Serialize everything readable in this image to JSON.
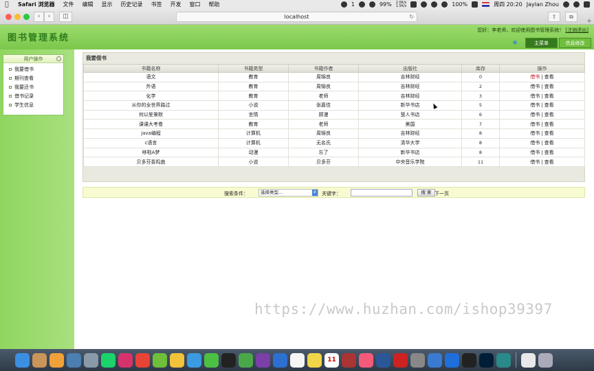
{
  "menubar": {
    "app_name": "Safari 浏览器",
    "items": [
      "文件",
      "编辑",
      "显示",
      "历史记录",
      "书签",
      "开发",
      "窗口",
      "帮助"
    ],
    "status": {
      "notif": "1",
      "battery": "100%",
      "cpu": "99%",
      "net_up": "2.0K/s",
      "net_down": "1.5K/s",
      "datetime": "周四 20:20",
      "user": "Jaylan Zhou"
    }
  },
  "browser": {
    "url": "localhost"
  },
  "app": {
    "brand": "图书管理系统",
    "greeting": "您好：李老师，欢迎使用图书管理系统！",
    "logout": "[注销退出]",
    "tabs": [
      "主菜单",
      "信息修改"
    ],
    "sidebar": {
      "title": "用户操作",
      "items": [
        "我要借书",
        "期刊查看",
        "我要还书",
        "借书记录",
        "学生信息"
      ]
    },
    "panel_title": "我要借书",
    "table": {
      "headers": [
        "书籍名称",
        "书籍类型",
        "书籍作者",
        "出版社",
        "库存",
        "操作"
      ],
      "rows": [
        [
          "语文",
          "教育",
          "周锦良",
          "吉林财经",
          "0"
        ],
        [
          "外语",
          "教育",
          "周锦良",
          "吉林财经",
          "2"
        ],
        [
          "化学",
          "教育",
          "老师",
          "吉林财经",
          "3"
        ],
        [
          "从你的全世界路过",
          "小说",
          "张嘉佳",
          "新华书店",
          "5"
        ],
        [
          "何以笙箫默",
          "言情",
          "顾漫",
          "萤人书店",
          "6"
        ],
        [
          "课课大考卷",
          "教育",
          "老师",
          "美国",
          "7"
        ],
        [
          "java编程",
          "计算机",
          "周锦良",
          "吉林财经",
          "8"
        ],
        [
          "c语言",
          "计算机",
          "无名氏",
          "清华大学",
          "8"
        ],
        [
          "哆啦A梦",
          "动漫",
          "忘了",
          "新华书店",
          "8"
        ],
        [
          "贝多芬奏鸣曲",
          "小说",
          "贝多芬",
          "中央音乐学院",
          "11"
        ]
      ],
      "action_borrow": "借书",
      "action_sep": "|",
      "action_view": "查看"
    },
    "search": {
      "label": "搜索条件：",
      "select_value": "选择类型...",
      "keyword_label": "关键字：",
      "keyword_value": "",
      "button": "搜 索",
      "next": "下一页"
    }
  },
  "watermark": "https://www.huzhan.com/ishop39397",
  "dock": {
    "calendar_day": "11",
    "apps": [
      "finder-icon",
      "contacts-icon",
      "photos-icon",
      "preview-icon",
      "launchpad-icon",
      "pycharm-icon",
      "intellij-icon",
      "chrome-icon",
      "leaf-icon",
      "notes-icon",
      "safari-icon",
      "wechat-icon",
      "qq-icon",
      "evernote-icon",
      "axure-icon",
      "xcode-icon",
      "textedit-icon",
      "stickies-icon",
      "calendar-icon",
      "photo-booth-icon",
      "music-icon",
      "word-icon",
      "remote-desktop-icon",
      "system-preferences-icon",
      "baidu-netdisk-icon",
      "teamviewer-icon",
      "qq-icon-2",
      "photoshop-icon",
      "edge-icon",
      "documents-icon",
      "trash-icon"
    ]
  }
}
